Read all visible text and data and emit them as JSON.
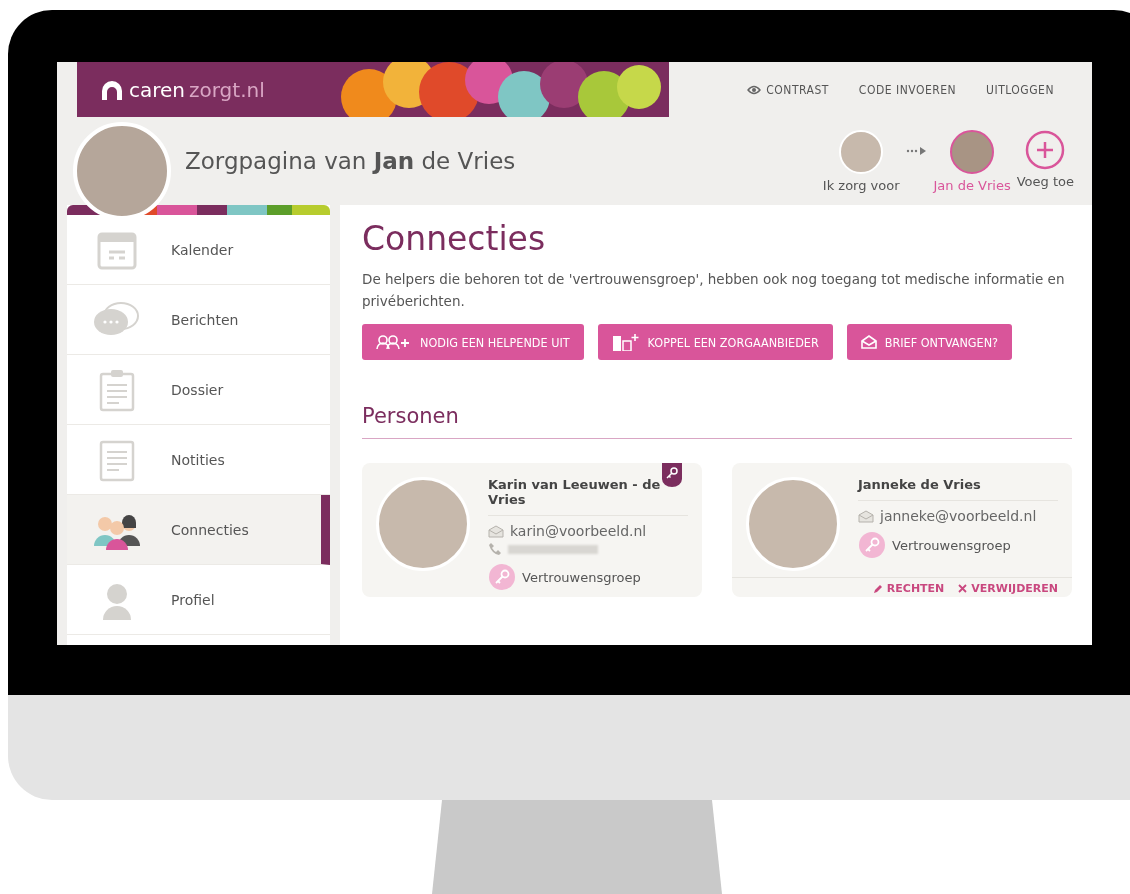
{
  "header": {
    "logo": {
      "brand": "caren",
      "domain": "zorgt.nl"
    },
    "nav": [
      {
        "label": "CONTRAST",
        "kind": "eye"
      },
      {
        "label": "CODE INVOEREN",
        "kind": "text"
      },
      {
        "label": "UITLOGGEN",
        "kind": "text"
      }
    ]
  },
  "profile": {
    "title": "Zorgpagina van **Jan** de Vries"
  },
  "switcher": [
    {
      "label": "Ik zorg voor",
      "kind": "person",
      "selected": false
    },
    {
      "label": "Jan de Vries",
      "kind": "person",
      "selected": true
    },
    {
      "label": "Voeg toe",
      "kind": "add",
      "selected": false
    }
  ],
  "sidebar": {
    "items": [
      {
        "label": "Kalender",
        "selected": false
      },
      {
        "label": "Berichten",
        "selected": false
      },
      {
        "label": "Dossier",
        "selected": false
      },
      {
        "label": "Notities",
        "selected": false
      },
      {
        "label": "Connecties",
        "selected": true
      },
      {
        "label": "Profiel",
        "selected": false
      }
    ]
  },
  "main": {
    "title": "Connecties",
    "description": "De helpers die behoren tot de 'vertrouwensgroep', hebben ook nog toegang tot medische informatie en privéberichten.",
    "buttons": [
      {
        "label": "NODIG EEN HELPENDE UIT"
      },
      {
        "label": "KOPPEL EEN ZORGAANBIEDER"
      },
      {
        "label": "BRIEF ONTVANGEN?"
      }
    ],
    "section_title": "Personen",
    "people": [
      {
        "name": "Karin van Leeuwen - de Vries",
        "email": "karin@voorbeeld.nl",
        "phone_hidden": true,
        "group": "Vertrouwensgroep",
        "key_badge": true
      },
      {
        "name": "Janneke de Vries",
        "email": "janneke@voorbeeld.nl",
        "phone_hidden": false,
        "group": "Vertrouwensgroep",
        "key_badge": false,
        "actions": [
          "RECHTEN",
          "VERWIJDEREN"
        ]
      }
    ]
  }
}
